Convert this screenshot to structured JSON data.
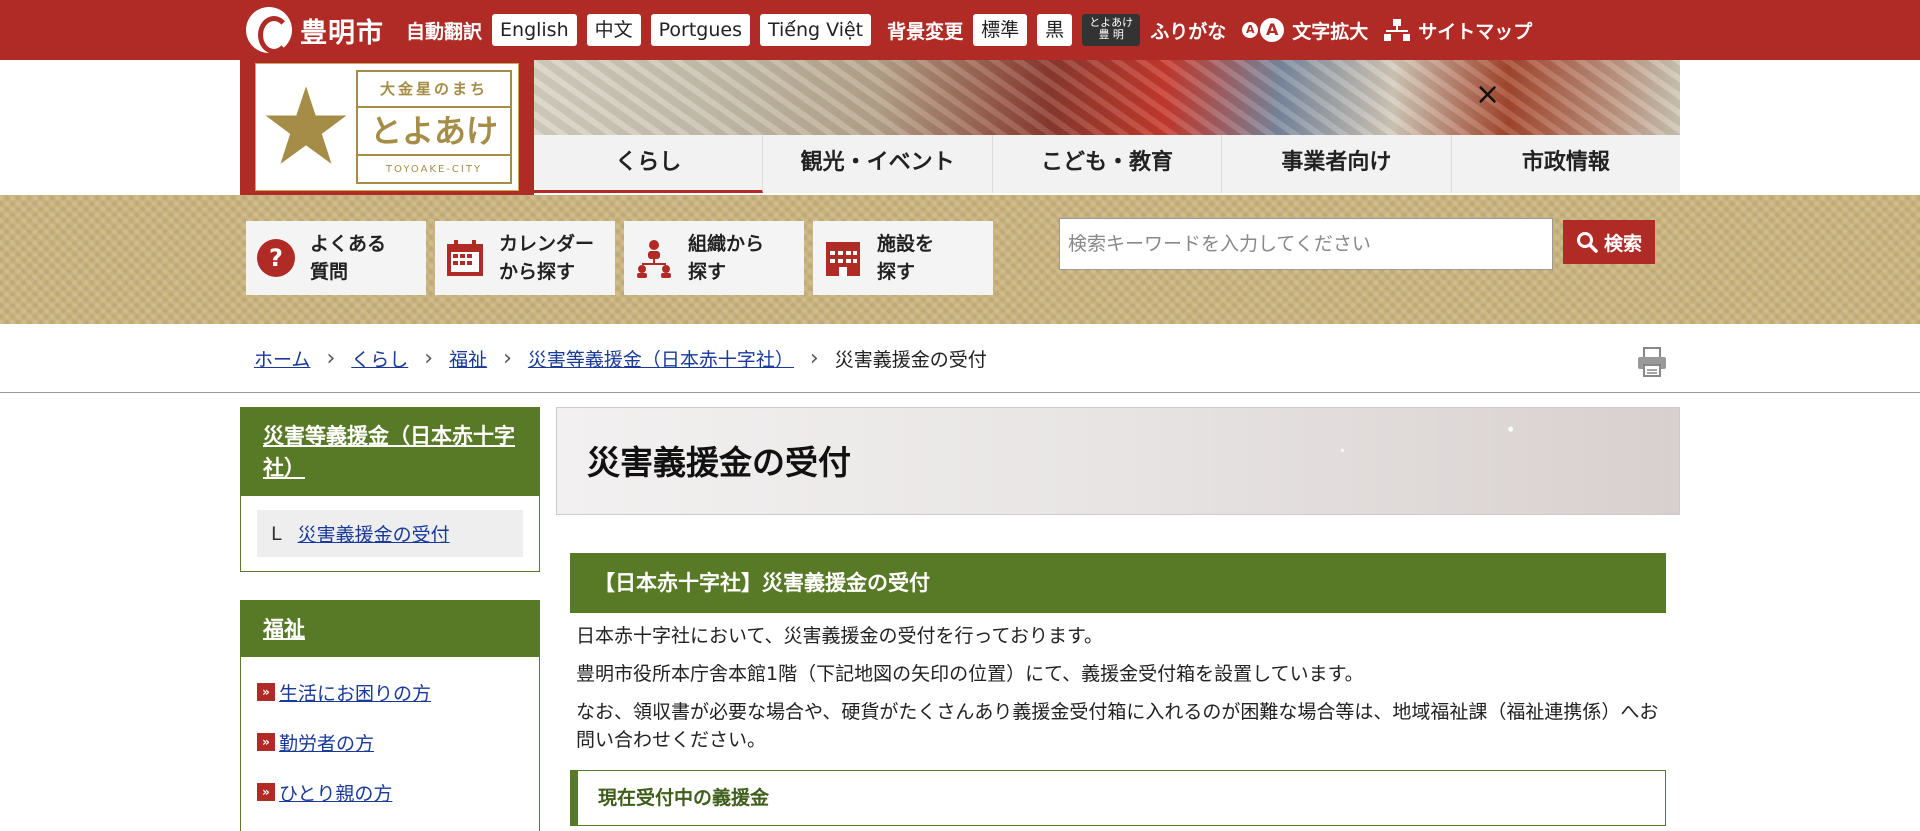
{
  "topbar": {
    "city_name": "豊明市",
    "auto_translate": "自動翻訳",
    "languages": [
      "English",
      "中文",
      "Portgues",
      "Tiế́ng Việt"
    ],
    "bg_change": "背景変更",
    "bg_options": [
      "標準",
      "黒"
    ],
    "kana_button": "とよあけ 豊 明",
    "furigana": "ふりがな",
    "font_small": "A",
    "font_large": "A",
    "font_enlarge": "文字拡大",
    "sitemap": "サイトマップ"
  },
  "logo": {
    "tagline": "大金星のまち",
    "name": "とよあけ",
    "roman": "TOYOAKE-CITY"
  },
  "banner_close": "×",
  "global_nav": [
    "くらし",
    "観光・イベント",
    "こども・教育",
    "事業者向け",
    "市政情報"
  ],
  "quick_links": [
    {
      "label": "よくある\n質問",
      "icon": "question-icon"
    },
    {
      "label": "カレンダー\nから探す",
      "icon": "calendar-icon"
    },
    {
      "label": "組織から\n探す",
      "icon": "organization-icon"
    },
    {
      "label": "施設を\n探す",
      "icon": "building-icon"
    }
  ],
  "search": {
    "placeholder": "検索キーワードを入力してください",
    "button": "検索"
  },
  "breadcrumb": [
    "ホーム",
    "くらし",
    "福祉",
    "災害等義援金（日本赤十字社）",
    "災害義援金の受付"
  ],
  "side": {
    "section1_title": "災害等義援金（日本赤十字社）",
    "section1_mark": "L",
    "section1_item": "災害義援金の受付",
    "section2_title": "福祉",
    "section2_items": [
      "生活にお困りの方",
      "勤労者の方",
      "ひとり親の方"
    ]
  },
  "main": {
    "title": "災害義援金の受付",
    "section_heading": "【日本赤十字社】災害義援金の受付",
    "para1": "日本赤十字社において、災害義援金の受付を行っております。",
    "para2": "豊明市役所本庁舎本館1階（下記地図の矢印の位置）にて、義援金受付箱を設置しています。",
    "para3": "なお、領収書が必要な場合や、硬貨がたくさんあり義援金受付箱に入れるのが困難な場合等は、地域福祉課（福祉連携係）へお問い合わせください。",
    "sub_heading": "現在受付中の義援金"
  },
  "colors": {
    "brand_red": "#b02b26",
    "green": "#587a26",
    "gold": "#c9b27b"
  }
}
